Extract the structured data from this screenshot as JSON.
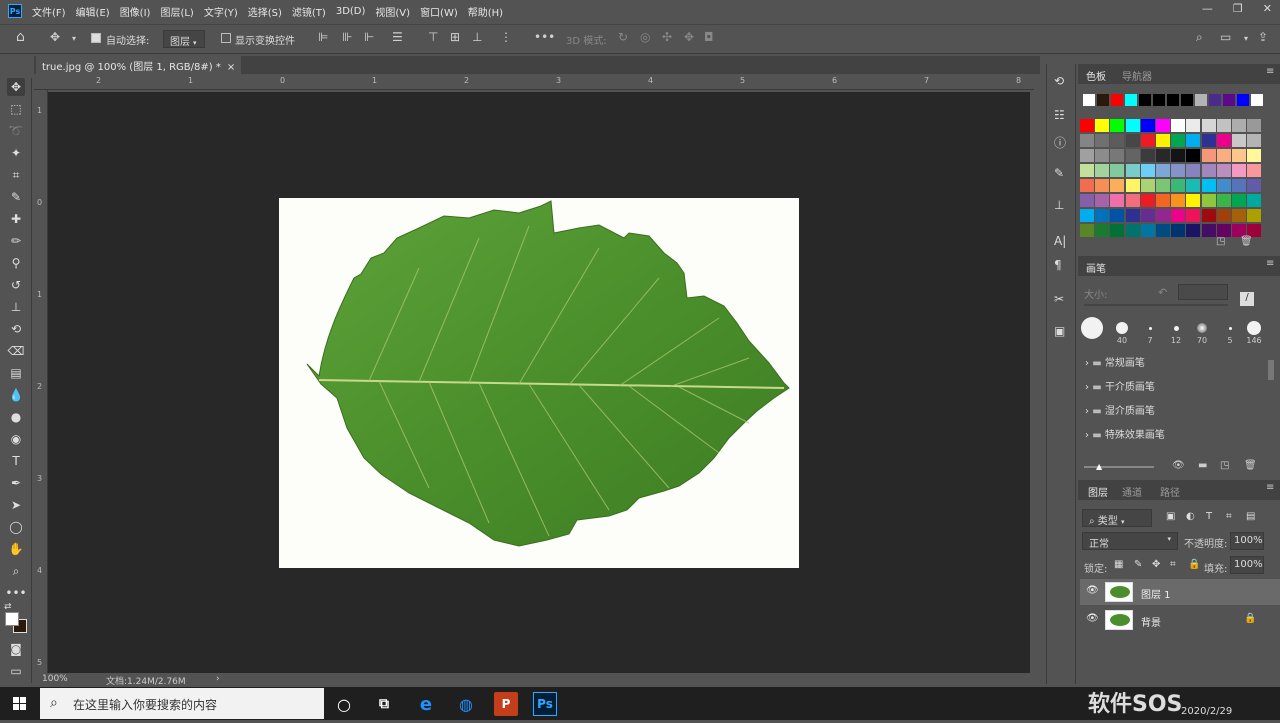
{
  "menu": {
    "items": [
      "文件(F)",
      "编辑(E)",
      "图像(I)",
      "图层(L)",
      "文字(Y)",
      "选择(S)",
      "滤镜(T)",
      "3D(D)",
      "视图(V)",
      "窗口(W)",
      "帮助(H)"
    ]
  },
  "options": {
    "auto_select_label": "自动选择:",
    "auto_select_value": "图层",
    "show_transform_label": "显示变换控件",
    "mode_3d_label": "3D 模式:"
  },
  "document": {
    "tab_title": "true.jpg @ 100% (图层 1, RGB/8#) *",
    "zoom": "100%",
    "doc_info": "文档:1.24M/2.76M",
    "ruler_h": [
      "2",
      "1",
      "0",
      "1",
      "2",
      "3",
      "4",
      "5",
      "6",
      "7",
      "8"
    ],
    "ruler_v": [
      "1",
      "0",
      "1",
      "2",
      "3",
      "4",
      "5"
    ]
  },
  "swatches": {
    "tab_active": "色板",
    "tab_inactive": "导航器",
    "row0": [
      "#ffffff",
      "#2a1a0c",
      "#ff0000",
      "#00ffff",
      "#000000",
      "#000000",
      "#000000",
      "#000000",
      "#b3b3b3",
      "#4a2c8c",
      "#5a0a8a",
      "#0000ff",
      "#ffffff"
    ],
    "grid": [
      [
        "#ff0000",
        "#ffff00",
        "#00ff00",
        "#00ffff",
        "#0000ff",
        "#ff00ff",
        "#ffffff",
        "#ebebeb",
        "#d6d6d6",
        "#c2c2c2",
        "#adadad",
        "#999999"
      ],
      [
        "#858585",
        "#707070",
        "#5c5c5c",
        "#474747",
        "#ed1c24",
        "#fff200",
        "#00a651",
        "#00aeef",
        "#2e3192",
        "#ec008c",
        "#c8c8c8",
        "#b4b4b4"
      ],
      [
        "#a0a0a0",
        "#8c8c8c",
        "#787878",
        "#646464",
        "#3c3c3c",
        "#282828",
        "#141414",
        "#000000",
        "#f7977a",
        "#fbad82",
        "#fdc68a",
        "#fff79a"
      ],
      [
        "#c4df9b",
        "#a2d39c",
        "#82ca9d",
        "#7accc8",
        "#6dcff6",
        "#7ea7d8",
        "#8493ca",
        "#8882be",
        "#a187be",
        "#bc8dbf",
        "#f49ac2",
        "#f6989d"
      ],
      [
        "#f26c4f",
        "#f68e55",
        "#fbaf5c",
        "#fff467",
        "#acd372",
        "#7cc576",
        "#3bb878",
        "#1abbb4",
        "#00bff3",
        "#438ccb",
        "#5574b9",
        "#605ca8"
      ],
      [
        "#855fa8",
        "#a763a8",
        "#f06ea9",
        "#f26d7d",
        "#ed1c24",
        "#f26522",
        "#f7941d",
        "#fff200",
        "#8dc63f",
        "#39b54a",
        "#00a651",
        "#00a99d"
      ],
      [
        "#00aeef",
        "#0072bc",
        "#0054a6",
        "#2e3192",
        "#662d91",
        "#92278f",
        "#ec008c",
        "#ed145b",
        "#9e0b0f",
        "#a0410d",
        "#a36209",
        "#aba000"
      ],
      [
        "#598527",
        "#1a7b30",
        "#007236",
        "#00746b",
        "#0076a3",
        "#004b80",
        "#003471",
        "#1b1464",
        "#440e62",
        "#630460",
        "#9e005d",
        "#9e0039"
      ]
    ]
  },
  "brushes": {
    "tab": "画笔",
    "size_label": "大小:",
    "presets": [
      "",
      "40",
      "7",
      "12",
      "70",
      "5",
      "146"
    ],
    "groups": [
      "常规画笔",
      "干介质画笔",
      "湿介质画笔",
      "特殊效果画笔"
    ]
  },
  "layers": {
    "tabs": [
      "图层",
      "通道",
      "路径"
    ],
    "filter_kind": "类型",
    "blend_mode": "正常",
    "opacity_label": "不透明度:",
    "opacity_value": "100%",
    "lock_label": "锁定:",
    "fill_label": "填充:",
    "fill_value": "100%",
    "items": [
      "图层 1",
      "背景"
    ]
  },
  "taskbar": {
    "search_placeholder": "在这里输入你要搜索的内容",
    "date": "2020/2/29",
    "watermark": "软件SOS"
  }
}
